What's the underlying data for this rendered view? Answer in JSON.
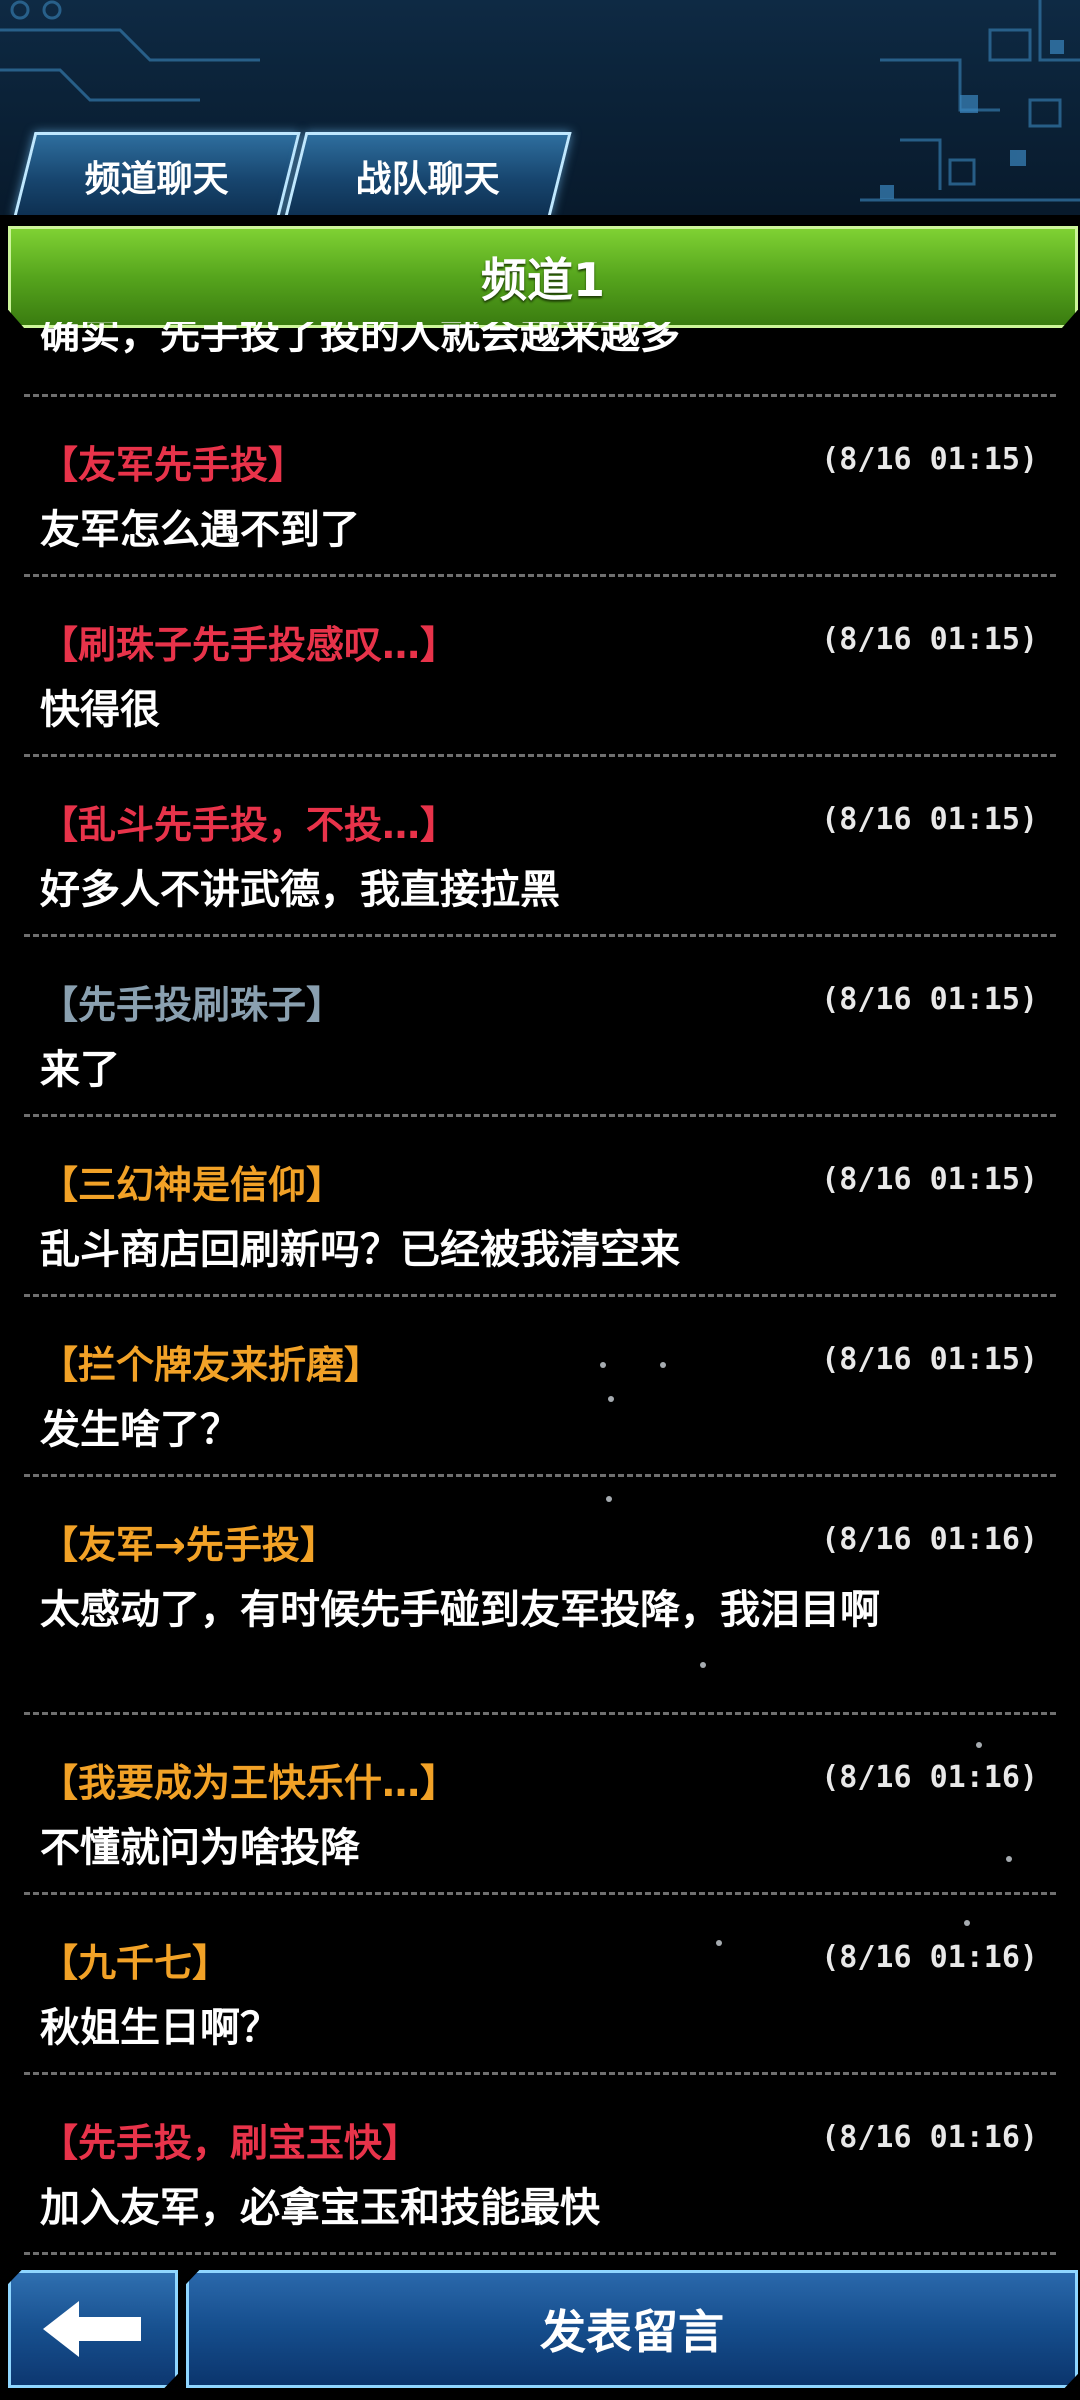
{
  "tabs": [
    {
      "label": "频道聊天"
    },
    {
      "label": "战队聊天"
    }
  ],
  "channel_title": "频道1",
  "partial_top_text": "确实，先手投了投的人就会越来越多",
  "messages": [
    {
      "name": "【友军先手投】",
      "color": "#e8334a",
      "time": "(8/16 01:15)",
      "text": "友军怎么遇不到了"
    },
    {
      "name": "【刷珠子先手投感叹…】",
      "color": "#e8334a",
      "time": "(8/16 01:15)",
      "text": "快得很"
    },
    {
      "name": "【乱斗先手投，不投…】",
      "color": "#e8334a",
      "time": "(8/16 01:15)",
      "text": "好多人不讲武德，我直接拉黑"
    },
    {
      "name": "【先手投刷珠子】",
      "color": "#8aa0b0",
      "time": "(8/16 01:15)",
      "text": "来了"
    },
    {
      "name": "【三幻神是信仰】",
      "color": "#f2a227",
      "time": "(8/16 01:15)",
      "text": "乱斗商店回刷新吗？已经被我清空来"
    },
    {
      "name": "【拦个牌友来折磨】",
      "color": "#f2a227",
      "time": "(8/16 01:15)",
      "text": "发生啥了？"
    },
    {
      "name": "【友军→先手投】",
      "color": "#f2a227",
      "time": "(8/16 01:16)",
      "text": "太感动了，有时候先手碰到友军投降，我泪目啊"
    },
    {
      "name": "【我要成为王快乐什…】",
      "color": "#f2a227",
      "time": "(8/16 01:16)",
      "text": "不懂就问为啥投降"
    },
    {
      "name": "【九千七】",
      "color": "#f2a227",
      "time": "(8/16 01:16)",
      "text": "秋姐生日啊？"
    },
    {
      "name": "【先手投，刷宝玉快】",
      "color": "#e8334a",
      "time": "(8/16 01:16)",
      "text": "加入友军，必拿宝玉和技能最快"
    }
  ],
  "back_icon": "arrow-left-icon",
  "post_button_label": "发表留言"
}
